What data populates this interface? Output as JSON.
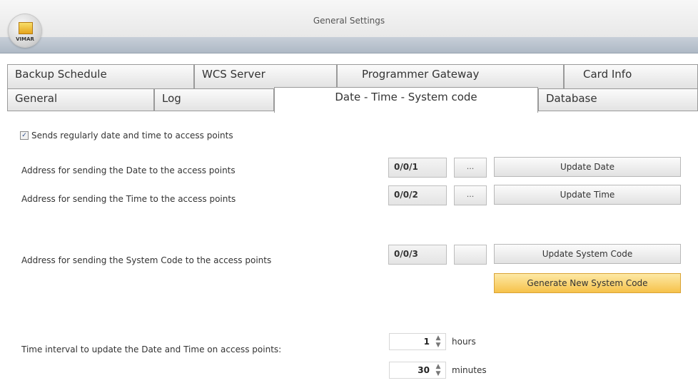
{
  "window": {
    "title": "General Settings",
    "app_logo_text": "VIMAR"
  },
  "tabs": {
    "row1": [
      "Backup Schedule",
      "WCS Server",
      "Programmer Gateway",
      "Card Info"
    ],
    "row2": [
      "General",
      "Log",
      "Date - Time - System code",
      "Database"
    ],
    "active": "Date - Time - System code"
  },
  "form": {
    "checkbox_label": "Sends regularly date and time to access points",
    "checkbox_checked": true,
    "date_label": "Address for sending the Date to the access points",
    "date_address": "0/0/1",
    "date_browse": "...",
    "update_date": "Update Date",
    "time_label": "Address for sending the Time to the access points",
    "time_address": "0/0/2",
    "time_browse": "...",
    "update_time": "Update Time",
    "syscode_label": "Address for sending the System Code to the access points",
    "syscode_address": "0/0/3",
    "syscode_browse": "",
    "update_syscode": "Update System Code",
    "generate_syscode": "Generate New System Code",
    "interval_label": "Time interval to update the Date and Time on access points:",
    "hours_value": "1",
    "hours_unit": "hours",
    "minutes_value": "30",
    "minutes_unit": "minutes"
  }
}
